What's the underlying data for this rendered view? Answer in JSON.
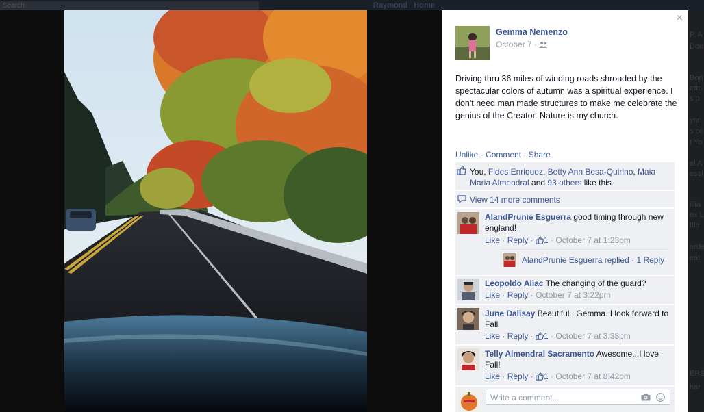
{
  "background": {
    "search_text": "Search",
    "nav_user": "Raymond",
    "nav_home": "Home"
  },
  "close_symbol": "×",
  "post": {
    "author": "Gemma Nemenzo",
    "date": "October 7",
    "date_sep": "·",
    "audience_icon": "friends-icon",
    "text": "Driving thru 36 miles of winding roads shrouded by the spectacular colors of autumn was a spiritual experience. I don't need man made structures to make me celebrate the genius of the Creator. Nature is my church.",
    "actions": {
      "unlike": "Unlike",
      "comment": "Comment",
      "share": "Share",
      "sep": "·"
    },
    "likes": {
      "you": "You, ",
      "names": [
        "Fides Enriquez",
        "Betty Ann Besa-Quirino",
        "Maia Maria Almendral"
      ],
      "comma": ", ",
      "and": " and ",
      "others": "93 others",
      "suffix": " like this."
    },
    "view_more": "View 14 more comments"
  },
  "comments": [
    {
      "name": "AlandPrunie Esguerra",
      "text": " good timing through new england!",
      "like": "Like",
      "reply": "Reply",
      "like_count": "1",
      "time": "October 7 at 1:23pm",
      "replies_summary": {
        "name": "AlandPrunie Esguerra replied",
        "sep": " · ",
        "count": "1 Reply"
      }
    },
    {
      "name": "Leopoldo Aliac",
      "text": " The changing of the guard?",
      "like": "Like",
      "reply": "Reply",
      "time": "October 7 at 3:22pm"
    },
    {
      "name": "June Dalisay",
      "text": " Beautiful , Gemma. I look forward to Fall",
      "like": "Like",
      "reply": "Reply",
      "like_count": "1",
      "time": "October 7 at 3:38pm"
    },
    {
      "name": "Telly Almendral Sacramento",
      "text": " Awesome...I love Fall!",
      "like": "Like",
      "reply": "Reply",
      "like_count": "1",
      "time": "October 7 at 8:42pm"
    }
  ],
  "write_comment": {
    "placeholder": "Write a comment..."
  },
  "colors": {
    "link": "#3b5998",
    "ufi_bg": "#eff0f3",
    "muted": "#9197a3"
  }
}
